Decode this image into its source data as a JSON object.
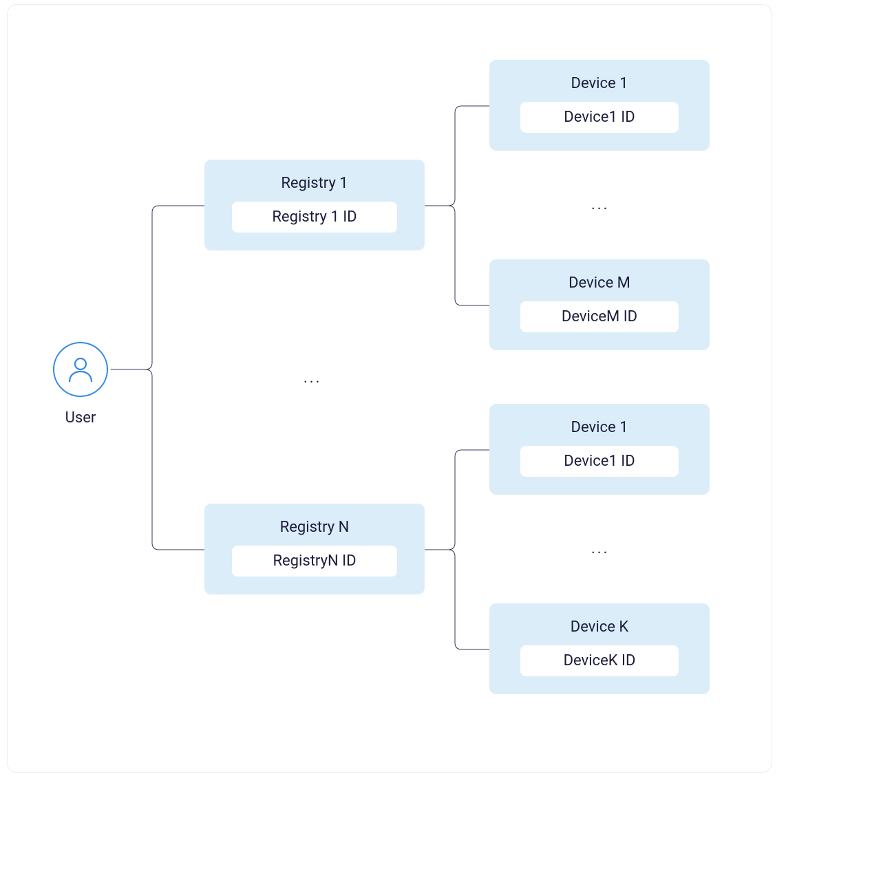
{
  "user": {
    "label": "User"
  },
  "ellipsis": "...",
  "registries": [
    {
      "title": "Registry 1",
      "id_label": "Registry 1 ID"
    },
    {
      "title": "Registry N",
      "id_label": "RegistryN ID"
    }
  ],
  "devices_top": [
    {
      "title": "Device 1",
      "id_label": "Device1 ID"
    },
    {
      "title": "Device M",
      "id_label": "DeviceM ID"
    }
  ],
  "devices_bottom": [
    {
      "title": "Device 1",
      "id_label": "Device1 ID"
    },
    {
      "title": "Device K",
      "id_label": "DeviceK ID"
    }
  ],
  "connectors": {
    "stroke": "#3a3556",
    "stroke_width": 1,
    "corner_radius": 10
  }
}
